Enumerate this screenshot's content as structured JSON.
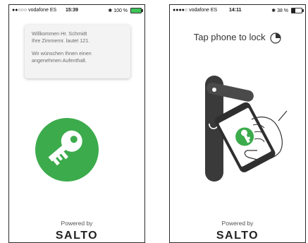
{
  "screens": {
    "left": {
      "status": {
        "carrier": "●●○○○ vodafone ES",
        "time": "15:39",
        "battery_text": "100 %",
        "battery_level": 1.0
      },
      "notification": {
        "line1": "Willkommen Hr. Schmidt",
        "line2": "Ihre Zimmernr. lautet 121.",
        "line3": "Wir wünschen Ihnen einen",
        "line4": "angenehmen Aufenthalt."
      },
      "icon": "key-icon",
      "powered_by": "Powered by",
      "brand": "SALTO"
    },
    "right": {
      "status": {
        "carrier": "●●●●○ vodafone ES",
        "time": "14:11",
        "battery_text": "38 %",
        "battery_level": 0.38
      },
      "title": "Tap phone to lock",
      "title_icon": "lock-clock-icon",
      "illustration": "hand-phone-door-handle",
      "powered_by": "Powered by",
      "brand": "SALTO"
    }
  },
  "colors": {
    "accent_green": "#3cab4c",
    "text_gray": "#6b6b6b",
    "dark_handle": "#3a3a3a"
  }
}
